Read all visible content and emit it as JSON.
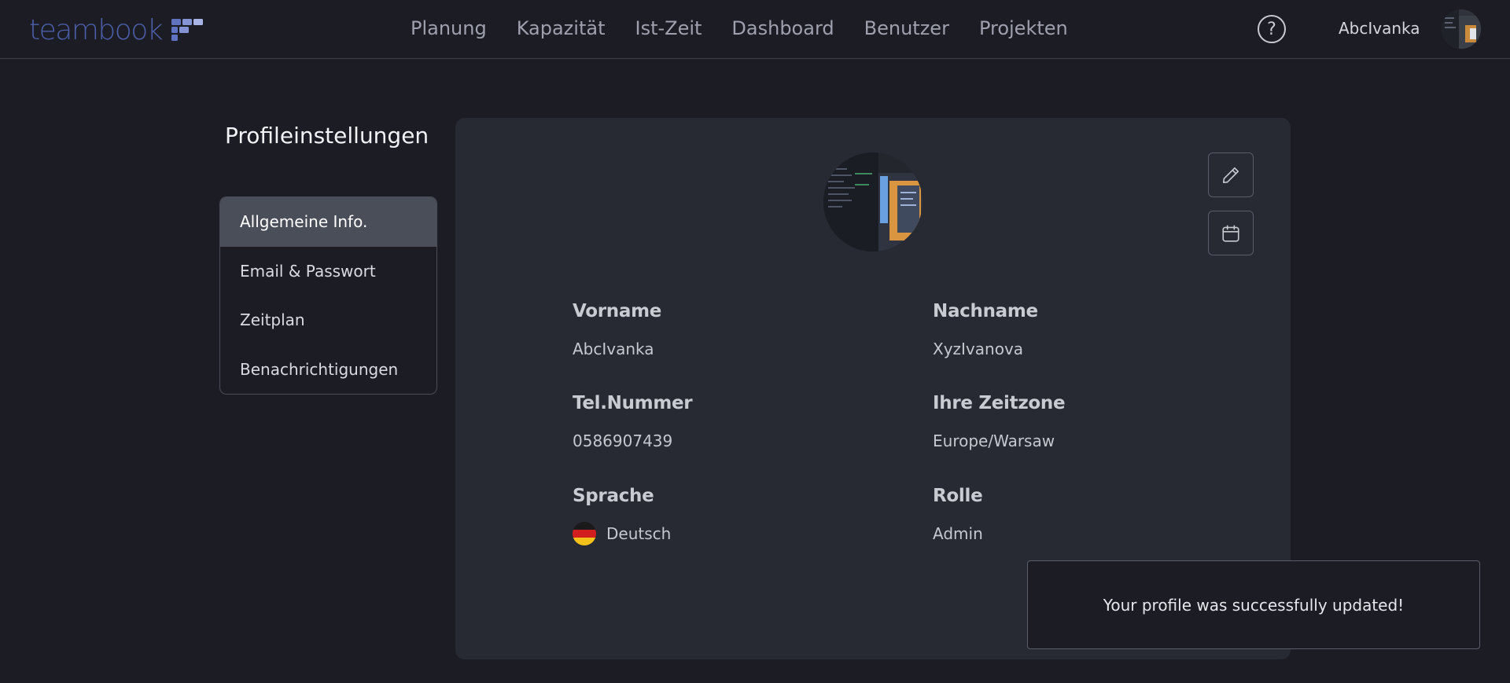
{
  "app": {
    "logo_text": "teambook",
    "brand_color": "#4c5ea8"
  },
  "nav": {
    "items": [
      "Planung",
      "Kapazität",
      "Ist-Zeit",
      "Dashboard",
      "Benutzer",
      "Projekten"
    ],
    "help_icon": "help-circle-icon"
  },
  "user": {
    "name": "AbcIvanka"
  },
  "settings": {
    "title": "Profileinstellungen",
    "menu": [
      {
        "label": "Allgemeine Info.",
        "active": true
      },
      {
        "label": "Email & Passwort",
        "active": false
      },
      {
        "label": "Zeitplan",
        "active": false
      },
      {
        "label": "Benachrichtigungen",
        "active": false
      }
    ]
  },
  "profile": {
    "edit_icon": "pencil-icon",
    "calendar_icon": "calendar-icon",
    "fields": {
      "first_name": {
        "label": "Vorname",
        "value": "AbcIvanka"
      },
      "last_name": {
        "label": "Nachname",
        "value": "XyzIvanova"
      },
      "phone": {
        "label": "Tel.Nummer",
        "value": "0586907439"
      },
      "timezone": {
        "label": "Ihre Zeitzone",
        "value": "Europe/Warsaw"
      },
      "language": {
        "label": "Sprache",
        "value": "Deutsch",
        "flag_icon": "germany-flag-icon"
      },
      "role": {
        "label": "Rolle",
        "value": "Admin"
      }
    }
  },
  "toast": {
    "message": "Your profile was successfully updated!"
  }
}
